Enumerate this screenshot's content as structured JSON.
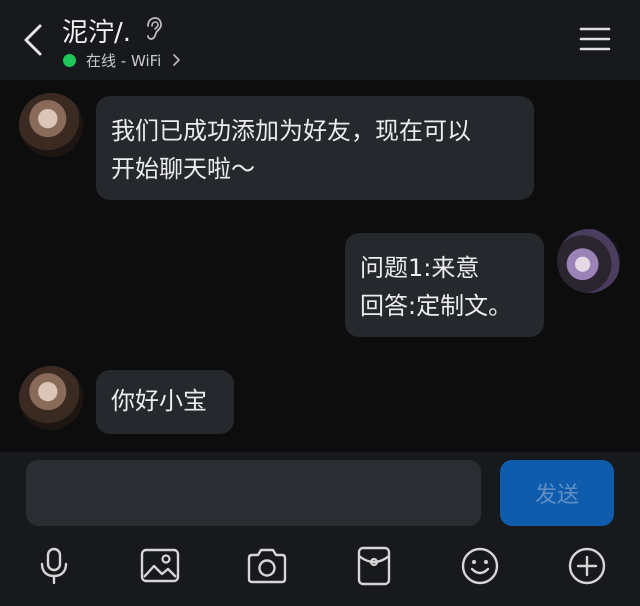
{
  "header": {
    "back_icon": "chevron-left-icon",
    "title": "泥泞/.",
    "mode_icon": "ear-icon",
    "status_text": "在线 - WiFi",
    "status_color": "#21c65b",
    "menu_icon": "hamburger-menu-icon"
  },
  "messages": [
    {
      "side": "left",
      "lines": [
        "我们已成功添加为好友，现在可以",
        "开始聊天啦～"
      ]
    },
    {
      "side": "right",
      "lines": [
        "问题1:来意",
        "回答:定制文。"
      ]
    },
    {
      "side": "left",
      "lines": [
        "你好小宝"
      ]
    }
  ],
  "composer": {
    "input_value": "",
    "send_label": "发送",
    "send_color": "#0e5cab"
  },
  "toolbar": {
    "items": [
      "microphone-icon",
      "image-icon",
      "camera-icon",
      "red-packet-icon",
      "emoji-icon",
      "plus-icon"
    ]
  }
}
